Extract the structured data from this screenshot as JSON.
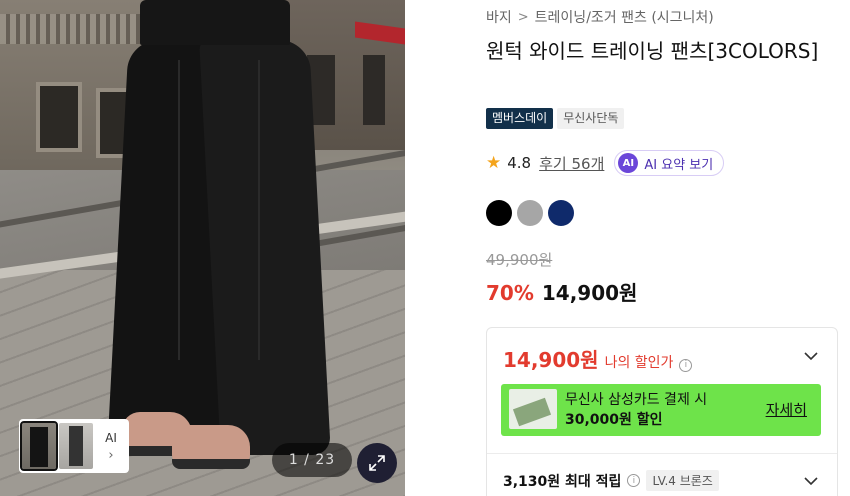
{
  "gallery": {
    "counter": "1 / 23",
    "thumb_ai_label": "AI",
    "thumb_ai_chevron": "›"
  },
  "breadcrumb": {
    "category": "바지",
    "separator": ">",
    "subcategory": "트레이닝/조거 팬츠 (시그니처)"
  },
  "product": {
    "title": "원턱 와이드 트레이닝 팬츠[3COLORS]",
    "badges": [
      "멤버스데이",
      "무신사단독"
    ],
    "rating": "4.8",
    "reviews": "후기 56개",
    "ai_summary": "AI 요약 보기",
    "ai_icon_text": "AI",
    "colors": [
      "#000000",
      "#a6a6a6",
      "#0f2a6b"
    ],
    "original_price": "49,900원",
    "discount": "70%",
    "price": "14,900원"
  },
  "benefit_card": {
    "my_price": "14,900원",
    "my_price_label": "나의 할인가",
    "info_glyph": "i",
    "promo_line1": "무신사 삼성카드 결제 시",
    "promo_line2": "30,000원 할인",
    "promo_detail": "자세히",
    "points": "3,130원 최대 적립",
    "level": "LV.4 브론즈"
  },
  "colors": {
    "accent_red": "#e23b2e",
    "promo_green": "#6ee34a",
    "member_badge": "#12304a",
    "ai_purple": "#6b46d9"
  }
}
